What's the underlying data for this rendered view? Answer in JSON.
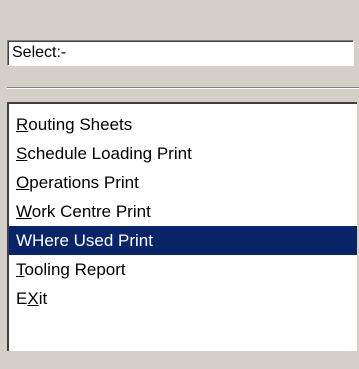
{
  "header": {
    "select_label": "Select:-"
  },
  "menu": {
    "items": [
      {
        "mnemonic": "R",
        "rest": "outing Sheets",
        "pre": ""
      },
      {
        "mnemonic": "S",
        "rest": "chedule Loading Print",
        "pre": ""
      },
      {
        "mnemonic": "O",
        "rest": "perations Print",
        "pre": ""
      },
      {
        "mnemonic": "W",
        "rest": "ork Centre Print",
        "pre": ""
      },
      {
        "mnemonic": "",
        "rest": "WHere Used Print",
        "pre": ""
      },
      {
        "mnemonic": "T",
        "rest": "ooling Report",
        "pre": ""
      },
      {
        "mnemonic": "X",
        "rest": "it",
        "pre": "E"
      }
    ],
    "selected_index": 4
  },
  "colors": {
    "window_bg": "#d4d0c8",
    "selection_bg": "#0a246a",
    "selection_text": "#ffffff"
  }
}
